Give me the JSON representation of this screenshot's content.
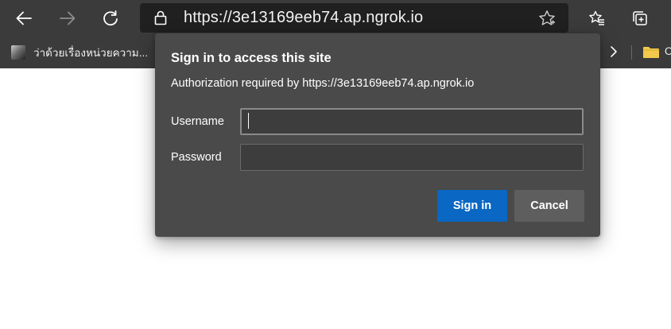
{
  "address_bar": {
    "url": "https://3e13169eeb74.ap.ngrok.io"
  },
  "toolbar": {
    "back_icon": "arrow-left-icon",
    "forward_icon": "arrow-right-icon",
    "refresh_icon": "refresh-icon",
    "lock_icon": "lock-icon",
    "favorite_icon": "star-icon",
    "favorites_list_icon": "favorites-icon",
    "collections_icon": "collections-icon"
  },
  "bookmarks_bar": {
    "items": [
      {
        "label": "ว่าด้วยเรื่องหน่วยความ..."
      }
    ],
    "folder_label": "O"
  },
  "dialog": {
    "title": "Sign in to access this site",
    "subtitle": "Authorization required by https://3e13169eeb74.ap.ngrok.io",
    "username_label": "Username",
    "username_value": "",
    "password_label": "Password",
    "password_value": "",
    "signin_label": "Sign in",
    "cancel_label": "Cancel"
  },
  "colors": {
    "toolbar_bg": "#3b3b3b",
    "address_bg": "#202020",
    "dialog_bg": "#4a4a4a",
    "primary_button": "#0a67c4",
    "secondary_button": "#5e5e5e"
  }
}
